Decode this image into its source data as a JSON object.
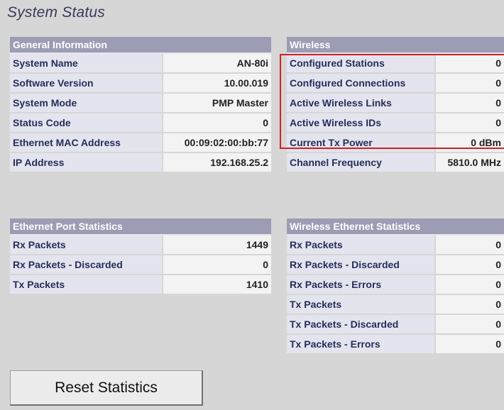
{
  "page_title": "System Status",
  "general": {
    "header": "General Information",
    "rows": [
      {
        "label": "System Name",
        "value": "AN-80i"
      },
      {
        "label": "Software Version",
        "value": "10.00.019"
      },
      {
        "label": "System Mode",
        "value": "PMP Master"
      },
      {
        "label": "Status Code",
        "value": "0"
      },
      {
        "label": "Ethernet MAC Address",
        "value": "00:09:02:00:bb:77"
      },
      {
        "label": "IP Address",
        "value": "192.168.25.2"
      }
    ]
  },
  "wireless": {
    "header": "Wireless",
    "rows": [
      {
        "label": "Configured Stations",
        "value": "0"
      },
      {
        "label": "Configured Connections",
        "value": "0"
      },
      {
        "label": "Active Wireless Links",
        "value": "0"
      },
      {
        "label": "Active Wireless IDs",
        "value": "0"
      },
      {
        "label": "Current Tx Power",
        "value": "0 dBm"
      },
      {
        "label": "Channel Frequency",
        "value": "5810.0 MHz"
      }
    ]
  },
  "ethernet_stats": {
    "header": "Ethernet Port Statistics",
    "rows": [
      {
        "label": "Rx Packets",
        "value": "1449"
      },
      {
        "label": "Rx Packets - Discarded",
        "value": "0"
      },
      {
        "label": "Tx Packets",
        "value": "1410"
      }
    ]
  },
  "wireless_stats": {
    "header": "Wireless Ethernet Statistics",
    "rows": [
      {
        "label": "Rx Packets",
        "value": "0"
      },
      {
        "label": "Rx Packets - Discarded",
        "value": "0"
      },
      {
        "label": "Rx Packets - Errors",
        "value": "0"
      },
      {
        "label": "Tx Packets",
        "value": "0"
      },
      {
        "label": "Tx Packets - Discarded",
        "value": "0"
      },
      {
        "label": "Tx Packets - Errors",
        "value": "0"
      }
    ]
  },
  "reset_button_label": "Reset Statistics",
  "colors": {
    "header_bg": "#9c9cb4",
    "label_bg": "#e4e4ee",
    "value_bg": "#f3f3f3",
    "highlight_border": "#d02020"
  }
}
